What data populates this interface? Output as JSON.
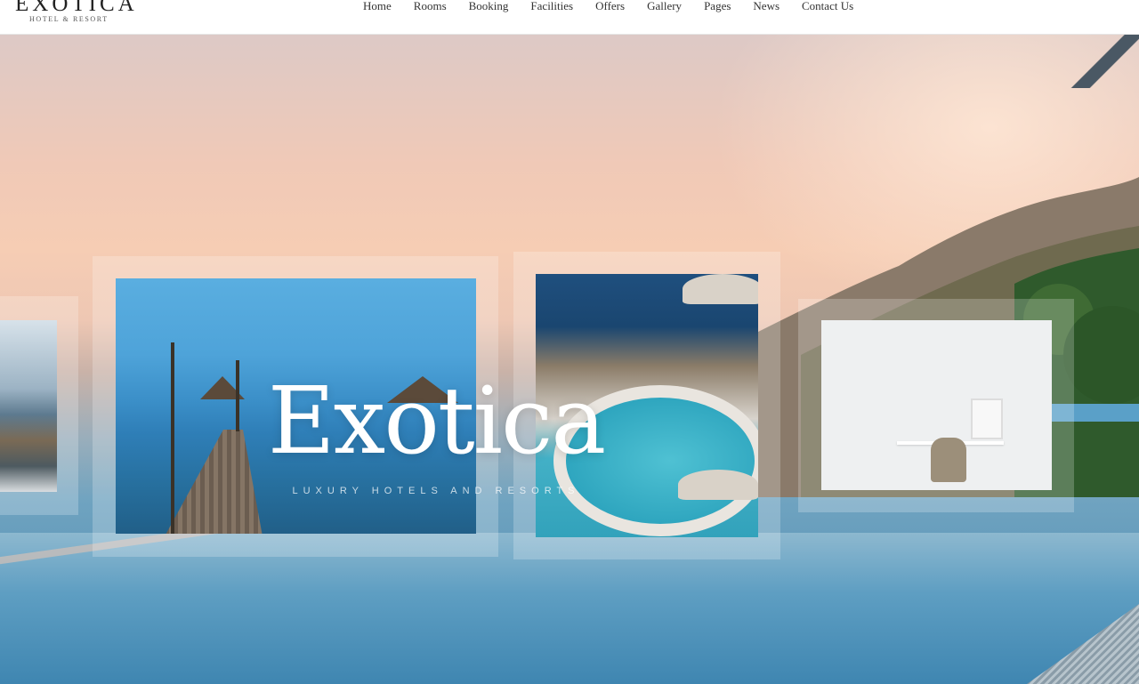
{
  "brand": {
    "logo_main": "EXOTICA",
    "logo_sub": "HOTEL & RESORT"
  },
  "nav": {
    "items": [
      {
        "label": "Home"
      },
      {
        "label": "Rooms"
      },
      {
        "label": "Booking"
      },
      {
        "label": "Facilities"
      },
      {
        "label": "Offers"
      },
      {
        "label": "Gallery"
      },
      {
        "label": "Pages"
      },
      {
        "label": "News"
      },
      {
        "label": "Contact Us"
      }
    ]
  },
  "hero": {
    "title": "Exotica",
    "subtitle": "LUXURY HOTELS AND RESORTS"
  },
  "colors": {
    "header_bg": "#ffffff",
    "text_dark": "#333333",
    "title_color": "#ffffff"
  }
}
